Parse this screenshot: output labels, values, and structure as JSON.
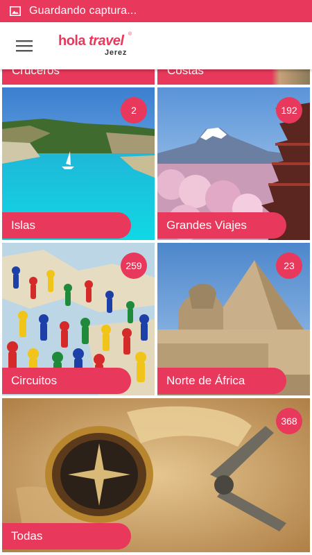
{
  "status_bar": {
    "text": "Guardando captura...",
    "icon": "image-icon",
    "color": "#e8385b"
  },
  "app_bar": {
    "menu_icon": "hamburger-menu-icon",
    "logo": {
      "hola": "hola",
      "travel": "travel",
      "registered": "®",
      "location": "Jerez"
    }
  },
  "accent_color": "#e8385b",
  "partial_row": [
    {
      "label": "Cruceros"
    },
    {
      "label": "Costas"
    }
  ],
  "categories": [
    {
      "label": "Islas",
      "count": "2"
    },
    {
      "label": "Grandes Viajes",
      "count": "192"
    },
    {
      "label": "Circuitos",
      "count": "259"
    },
    {
      "label": "Norte de África",
      "count": "23"
    },
    {
      "label": "Todas",
      "count": "368"
    }
  ]
}
